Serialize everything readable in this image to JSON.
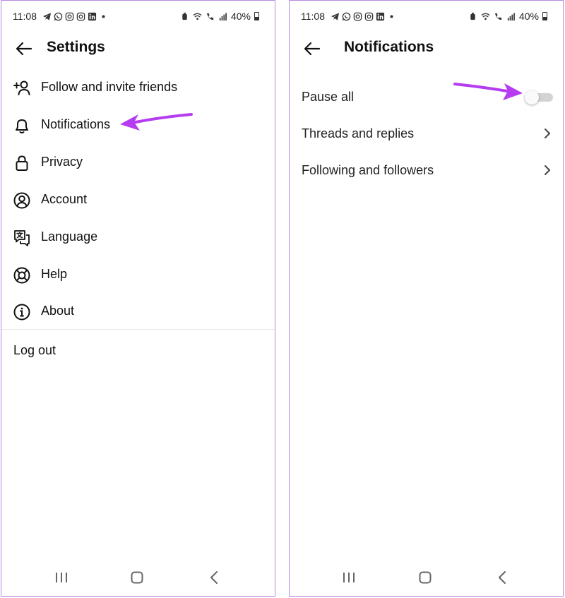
{
  "colors": {
    "accent_arrow": "#b53cf0",
    "frame_border": "#b58ae0",
    "toggle_off": "#d3d3d3"
  },
  "status_bar": {
    "time": "11:08",
    "battery": "40%",
    "left_icons": [
      "telegram-icon",
      "whatsapp-icon",
      "instagram-icon",
      "instagram-icon",
      "linkedin-icon",
      "dot-icon"
    ],
    "right_icons": [
      "alarm-icon",
      "wifi-icon",
      "call-icon",
      "signal-icon",
      "battery-icon"
    ]
  },
  "settings_screen": {
    "title": "Settings",
    "items": [
      {
        "label": "Follow and invite friends",
        "icon": "add-person-icon"
      },
      {
        "label": "Notifications",
        "icon": "bell-icon"
      },
      {
        "label": "Privacy",
        "icon": "lock-icon"
      },
      {
        "label": "Account",
        "icon": "account-circle-icon"
      },
      {
        "label": "Language",
        "icon": "translate-icon"
      },
      {
        "label": "Help",
        "icon": "lifebuoy-icon"
      },
      {
        "label": "About",
        "icon": "info-icon"
      }
    ],
    "logout": "Log out"
  },
  "notifications_screen": {
    "title": "Notifications",
    "pause_all": {
      "label": "Pause all",
      "enabled": false
    },
    "rows": [
      {
        "label": "Threads and replies",
        "icon": "chevron-right-icon"
      },
      {
        "label": "Following and followers",
        "icon": "chevron-right-icon"
      }
    ]
  },
  "nav_bar": [
    "recent-apps-icon",
    "home-icon",
    "back-icon"
  ]
}
